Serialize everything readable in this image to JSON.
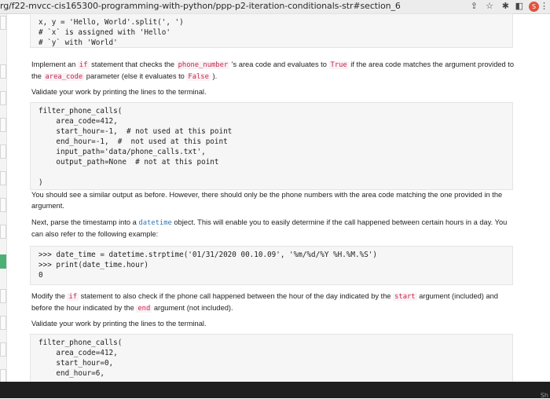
{
  "browser": {
    "url": "rg/f22-mvcc-cis165300-programming-with-python/ppp-p2-iteration-conditionals-str#section_6",
    "profile_initial": "S"
  },
  "code_block_1": {
    "lines": "x, y = 'Hello, World'.split(', ')\n# `x` is assigned with 'Hello'\n# `y` with 'World'"
  },
  "para_1": {
    "t1": "Implement an ",
    "c1": "if",
    "t2": " statement that checks the ",
    "c2": "phone_number",
    "t3": " 's area code and evaluates to ",
    "c3": "True",
    "t4": " if the area code matches the argument provided to the ",
    "c4": "area_code",
    "t5": " parameter (else it evaluates to ",
    "c5": "False",
    "t6": " )."
  },
  "para_2": "Validate your work by printing the lines to the terminal.",
  "code_block_2": {
    "lines": "filter_phone_calls(\n    area_code=412,\n    start_hour=-1,  # not used at this point\n    end_hour=-1,  #  not used at this point\n    input_path='data/phone_calls.txt',\n    output_path=None  # not at this point\n\n)"
  },
  "para_3": "You should see a similar output as before. However, there should only be the phone numbers with the area code matching the one provided in the argument.",
  "para_4": {
    "t1": "Next, parse the timestamp into a ",
    "c1": "datetime",
    "t2": " object. This will enable you to easily determine if the call happened between certain hours in a day. You can also refer to the following example:"
  },
  "code_block_3": {
    "lines": ">>> date_time = datetime.strptime('01/31/2020 00.10.09', '%m/%d/%Y %H.%M.%S')\n>>> print(date_time.hour)\n0"
  },
  "para_5": {
    "t1": "Modify the ",
    "c1": "if",
    "t2": " statement to also check if the phone call happened between the hour of the day indicated by the ",
    "c2": "start",
    "t3": " argument (included) and before the hour indicated by the ",
    "c3": "end",
    "t4": " argument (not included)."
  },
  "para_6": "Validate your work by printing the lines to the terminal.",
  "code_block_4": {
    "lines": "filter_phone_calls(\n    area_code=412,\n    start_hour=0,\n    end_hour=6,"
  },
  "taskbar": {
    "label": "Sh"
  }
}
